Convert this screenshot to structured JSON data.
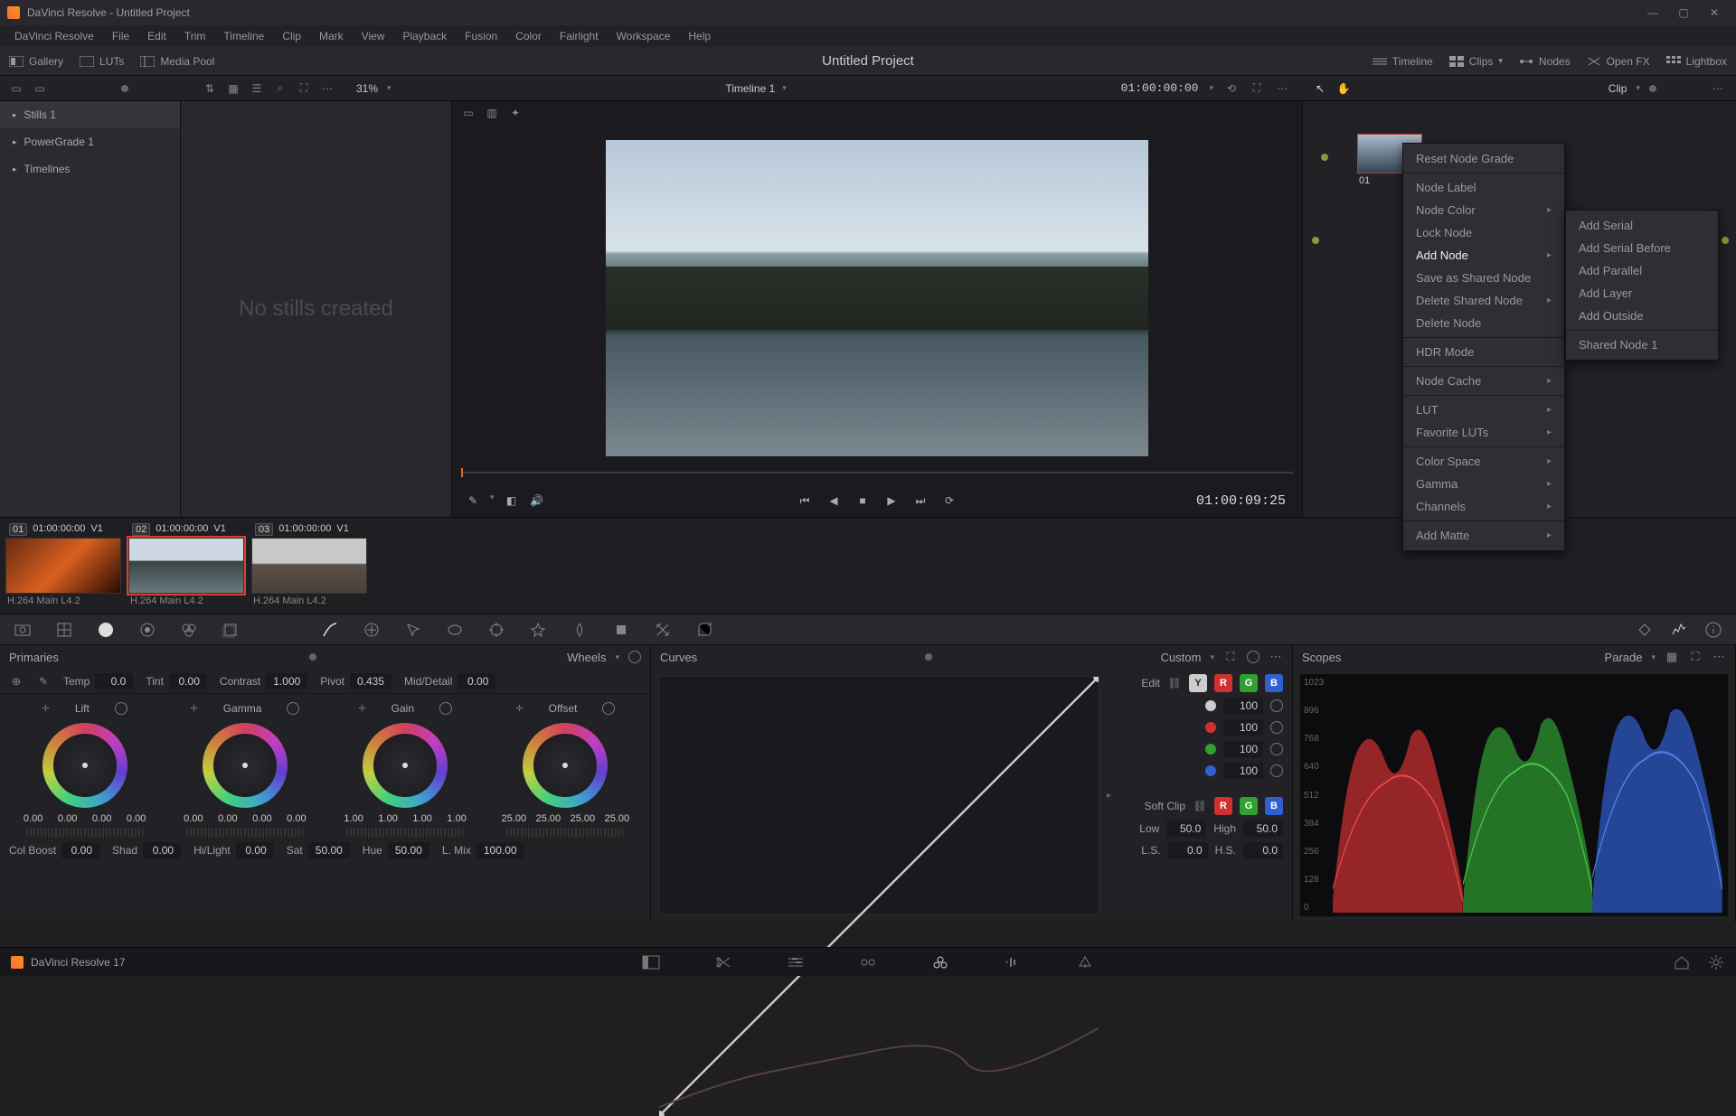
{
  "window": {
    "title": "DaVinci Resolve - Untitled Project"
  },
  "menu": [
    "DaVinci Resolve",
    "File",
    "Edit",
    "Trim",
    "Timeline",
    "Clip",
    "Mark",
    "View",
    "Playback",
    "Fusion",
    "Color",
    "Fairlight",
    "Workspace",
    "Help"
  ],
  "toolbar": {
    "gallery": "Gallery",
    "luts": "LUTs",
    "mediapool": "Media Pool",
    "timeline": "Timeline",
    "clips": "Clips",
    "nodes": "Nodes",
    "openfx": "Open FX",
    "lightbox": "Lightbox",
    "project": "Untitled Project"
  },
  "subbar": {
    "zoom": "31%",
    "timeline_name": "Timeline 1",
    "record_tc": "01:00:00:00",
    "clip_mode": "Clip"
  },
  "sidebar": {
    "items": [
      "Stills 1",
      "PowerGrade 1",
      "Timelines"
    ]
  },
  "stills_placeholder": "No stills created",
  "viewer": {
    "timecode": "01:00:09:25"
  },
  "node": {
    "label": "01"
  },
  "ctx_main": [
    "Reset Node Grade",
    "Node Label",
    "Node Color",
    "Lock Node",
    "Add Node",
    "Save as Shared Node",
    "Delete Shared Node",
    "Delete Node",
    "HDR Mode",
    "Node Cache",
    "LUT",
    "Favorite LUTs",
    "Color Space",
    "Gamma",
    "Channels",
    "Add Matte"
  ],
  "ctx_sub": [
    "Add Serial",
    "Add Serial Before",
    "Add Parallel",
    "Add Layer",
    "Add Outside",
    "Shared Node 1"
  ],
  "clips": [
    {
      "num": "01",
      "tc": "01:00:00:00",
      "track": "V1",
      "meta": "H.264 Main L4.2",
      "bg": "linear-gradient(135deg,#6a2a10,#d86020,#2a0a00)"
    },
    {
      "num": "02",
      "tc": "01:00:00:00",
      "track": "V1",
      "meta": "H.264 Main L4.2",
      "bg": "linear-gradient(to bottom,#cdd8e2 0%,#cdd8e2 40%,#3a4540 42%,#6a7880 100%)"
    },
    {
      "num": "03",
      "tc": "01:00:00:00",
      "track": "V1",
      "meta": "H.264 Main L4.2",
      "bg": "linear-gradient(to bottom,#c8c8c8 0%,#c8c8c8 45%,#5a5048 48%,#4a4038 100%)"
    }
  ],
  "primaries": {
    "title": "Primaries",
    "mode": "Wheels",
    "top": {
      "temp": "0.0",
      "tint": "0.00",
      "contrast": "1.000",
      "pivot": "0.435",
      "mid": "0.00"
    },
    "temp_l": "Temp",
    "tint_l": "Tint",
    "contrast_l": "Contrast",
    "pivot_l": "Pivot",
    "mid_l": "Mid/Detail",
    "wheels": [
      {
        "name": "Lift",
        "vals": [
          "0.00",
          "0.00",
          "0.00",
          "0.00"
        ]
      },
      {
        "name": "Gamma",
        "vals": [
          "0.00",
          "0.00",
          "0.00",
          "0.00"
        ]
      },
      {
        "name": "Gain",
        "vals": [
          "1.00",
          "1.00",
          "1.00",
          "1.00"
        ]
      },
      {
        "name": "Offset",
        "vals": [
          "25.00",
          "25.00",
          "25.00",
          "25.00"
        ]
      }
    ],
    "bottom": {
      "colboost_l": "Col Boost",
      "colboost": "0.00",
      "shad_l": "Shad",
      "shad": "0.00",
      "hilight_l": "Hi/Light",
      "hilight": "0.00",
      "sat_l": "Sat",
      "sat": "50.00",
      "hue_l": "Hue",
      "hue": "50.00",
      "lmix_l": "L. Mix",
      "lmix": "100.00"
    }
  },
  "curves": {
    "title": "Curves",
    "mode": "Custom",
    "edit_l": "Edit",
    "softclip_l": "Soft Clip",
    "vals": [
      "100",
      "100",
      "100",
      "100"
    ],
    "low_l": "Low",
    "low": "50.0",
    "high_l": "High",
    "high": "50.0",
    "ls_l": "L.S.",
    "ls": "0.0",
    "hs_l": "H.S.",
    "hs": "0.0"
  },
  "scopes": {
    "title": "Scopes",
    "mode": "Parade",
    "ticks": [
      "1023",
      "896",
      "768",
      "640",
      "512",
      "384",
      "256",
      "128",
      "0"
    ]
  },
  "statusbar": {
    "app": "DaVinci Resolve 17"
  }
}
